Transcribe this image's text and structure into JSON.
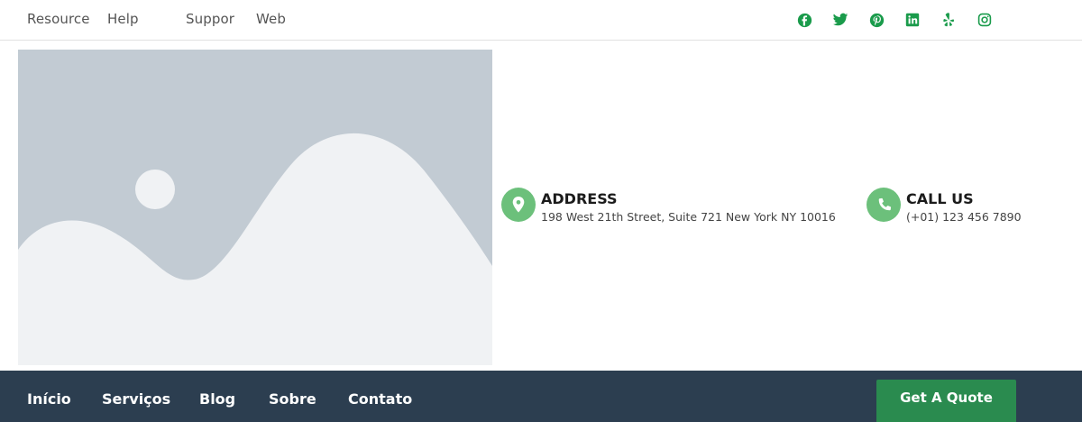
{
  "topbar": {
    "links": [
      "Resource",
      "Help",
      "Suppor",
      "Web"
    ],
    "social_icons": [
      "facebook-icon",
      "twitter-icon",
      "pinterest-icon",
      "linkedin-icon",
      "yelp-icon",
      "instagram-icon"
    ],
    "icon_color": "#1a9b4b"
  },
  "hero_image": {
    "type": "placeholder-image",
    "background": "#c2cbd3",
    "foreground": "#f0f2f4"
  },
  "contact": {
    "address": {
      "title": "ADDRESS",
      "text": "198 West 21th Street, Suite 721 New York NY 10016",
      "icon": "map-pin-icon"
    },
    "call": {
      "title": "CALL US",
      "text": "(+01) 123 456 7890",
      "icon": "phone-icon"
    },
    "icon_bg": "#6cc07b"
  },
  "nav": {
    "items": [
      "Início",
      "Serviços",
      "Blog",
      "Sobre",
      "Contato"
    ],
    "background": "#2c3e50",
    "cta_label": "Get A Quote",
    "cta_color": "#2a8b4f"
  }
}
